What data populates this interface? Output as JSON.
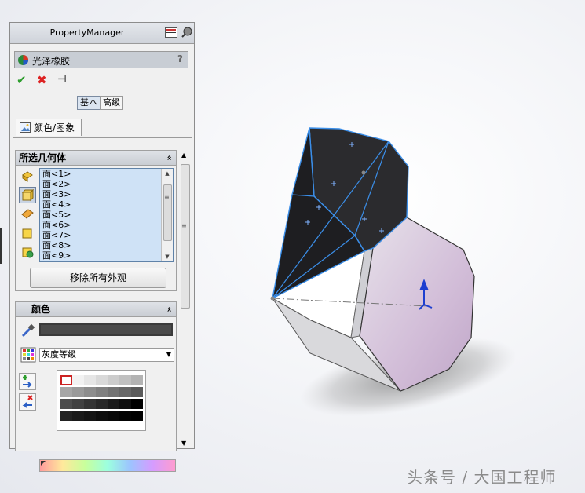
{
  "property_manager": {
    "title": "PropertyManager",
    "feature_name": "光泽橡胶",
    "help_symbol": "?",
    "confirm_symbols": {
      "ok": "✔",
      "cancel": "✖",
      "pin": "⊣"
    },
    "mode_tabs": [
      "基本",
      "高级"
    ],
    "active_mode": "基本",
    "tab": {
      "label": "颜色/图象"
    }
  },
  "geometry_group": {
    "title": "所选几何体",
    "collapse_symbol": "«",
    "faces": [
      "面<1>",
      "面<2>",
      "面<3>",
      "面<4>",
      "面<5>",
      "面<6>",
      "面<7>",
      "面<8>",
      "面<9>"
    ],
    "remove_button": "移除所有外观"
  },
  "color_group": {
    "title": "颜色",
    "collapse_symbol": "«",
    "current_color": "#4a4a4a",
    "preset_value": "灰度等级",
    "palette_colors": [
      [
        "#ffffff",
        "#f2f2f2",
        "#e6e6e6",
        "#d9d9d9",
        "#cccccc",
        "#c0c0c0",
        "#b3b3b3"
      ],
      [
        "#a6a6a6",
        "#9a9a9a",
        "#8d8d8d",
        "#808080",
        "#737373",
        "#676767",
        "#5a5a5a"
      ],
      [
        "#4d4d4d",
        "#414141",
        "#343434",
        "#282828",
        "#1b1b1b",
        "#0f0f0f",
        "#000000"
      ],
      [
        "#222222",
        "#1a1a1a",
        "#141414",
        "#0d0d0d",
        "#080808",
        "#030303",
        "#000000"
      ]
    ]
  },
  "icons": {
    "title_icons": [
      "display-pane-icon",
      "appearance-icon"
    ],
    "feature_icon": "appearance-ball-icon",
    "tab_icon": "image-icon",
    "filters": [
      "filter-part-icon",
      "filter-face-icon",
      "filter-surface-icon",
      "filter-body-icon",
      "filter-feature-icon"
    ],
    "color_tools": [
      "eyedropper-icon",
      "color-swatch-icon",
      "add-color-icon",
      "remove-color-icon"
    ]
  },
  "watermark": "头条号 / 大国工程师"
}
